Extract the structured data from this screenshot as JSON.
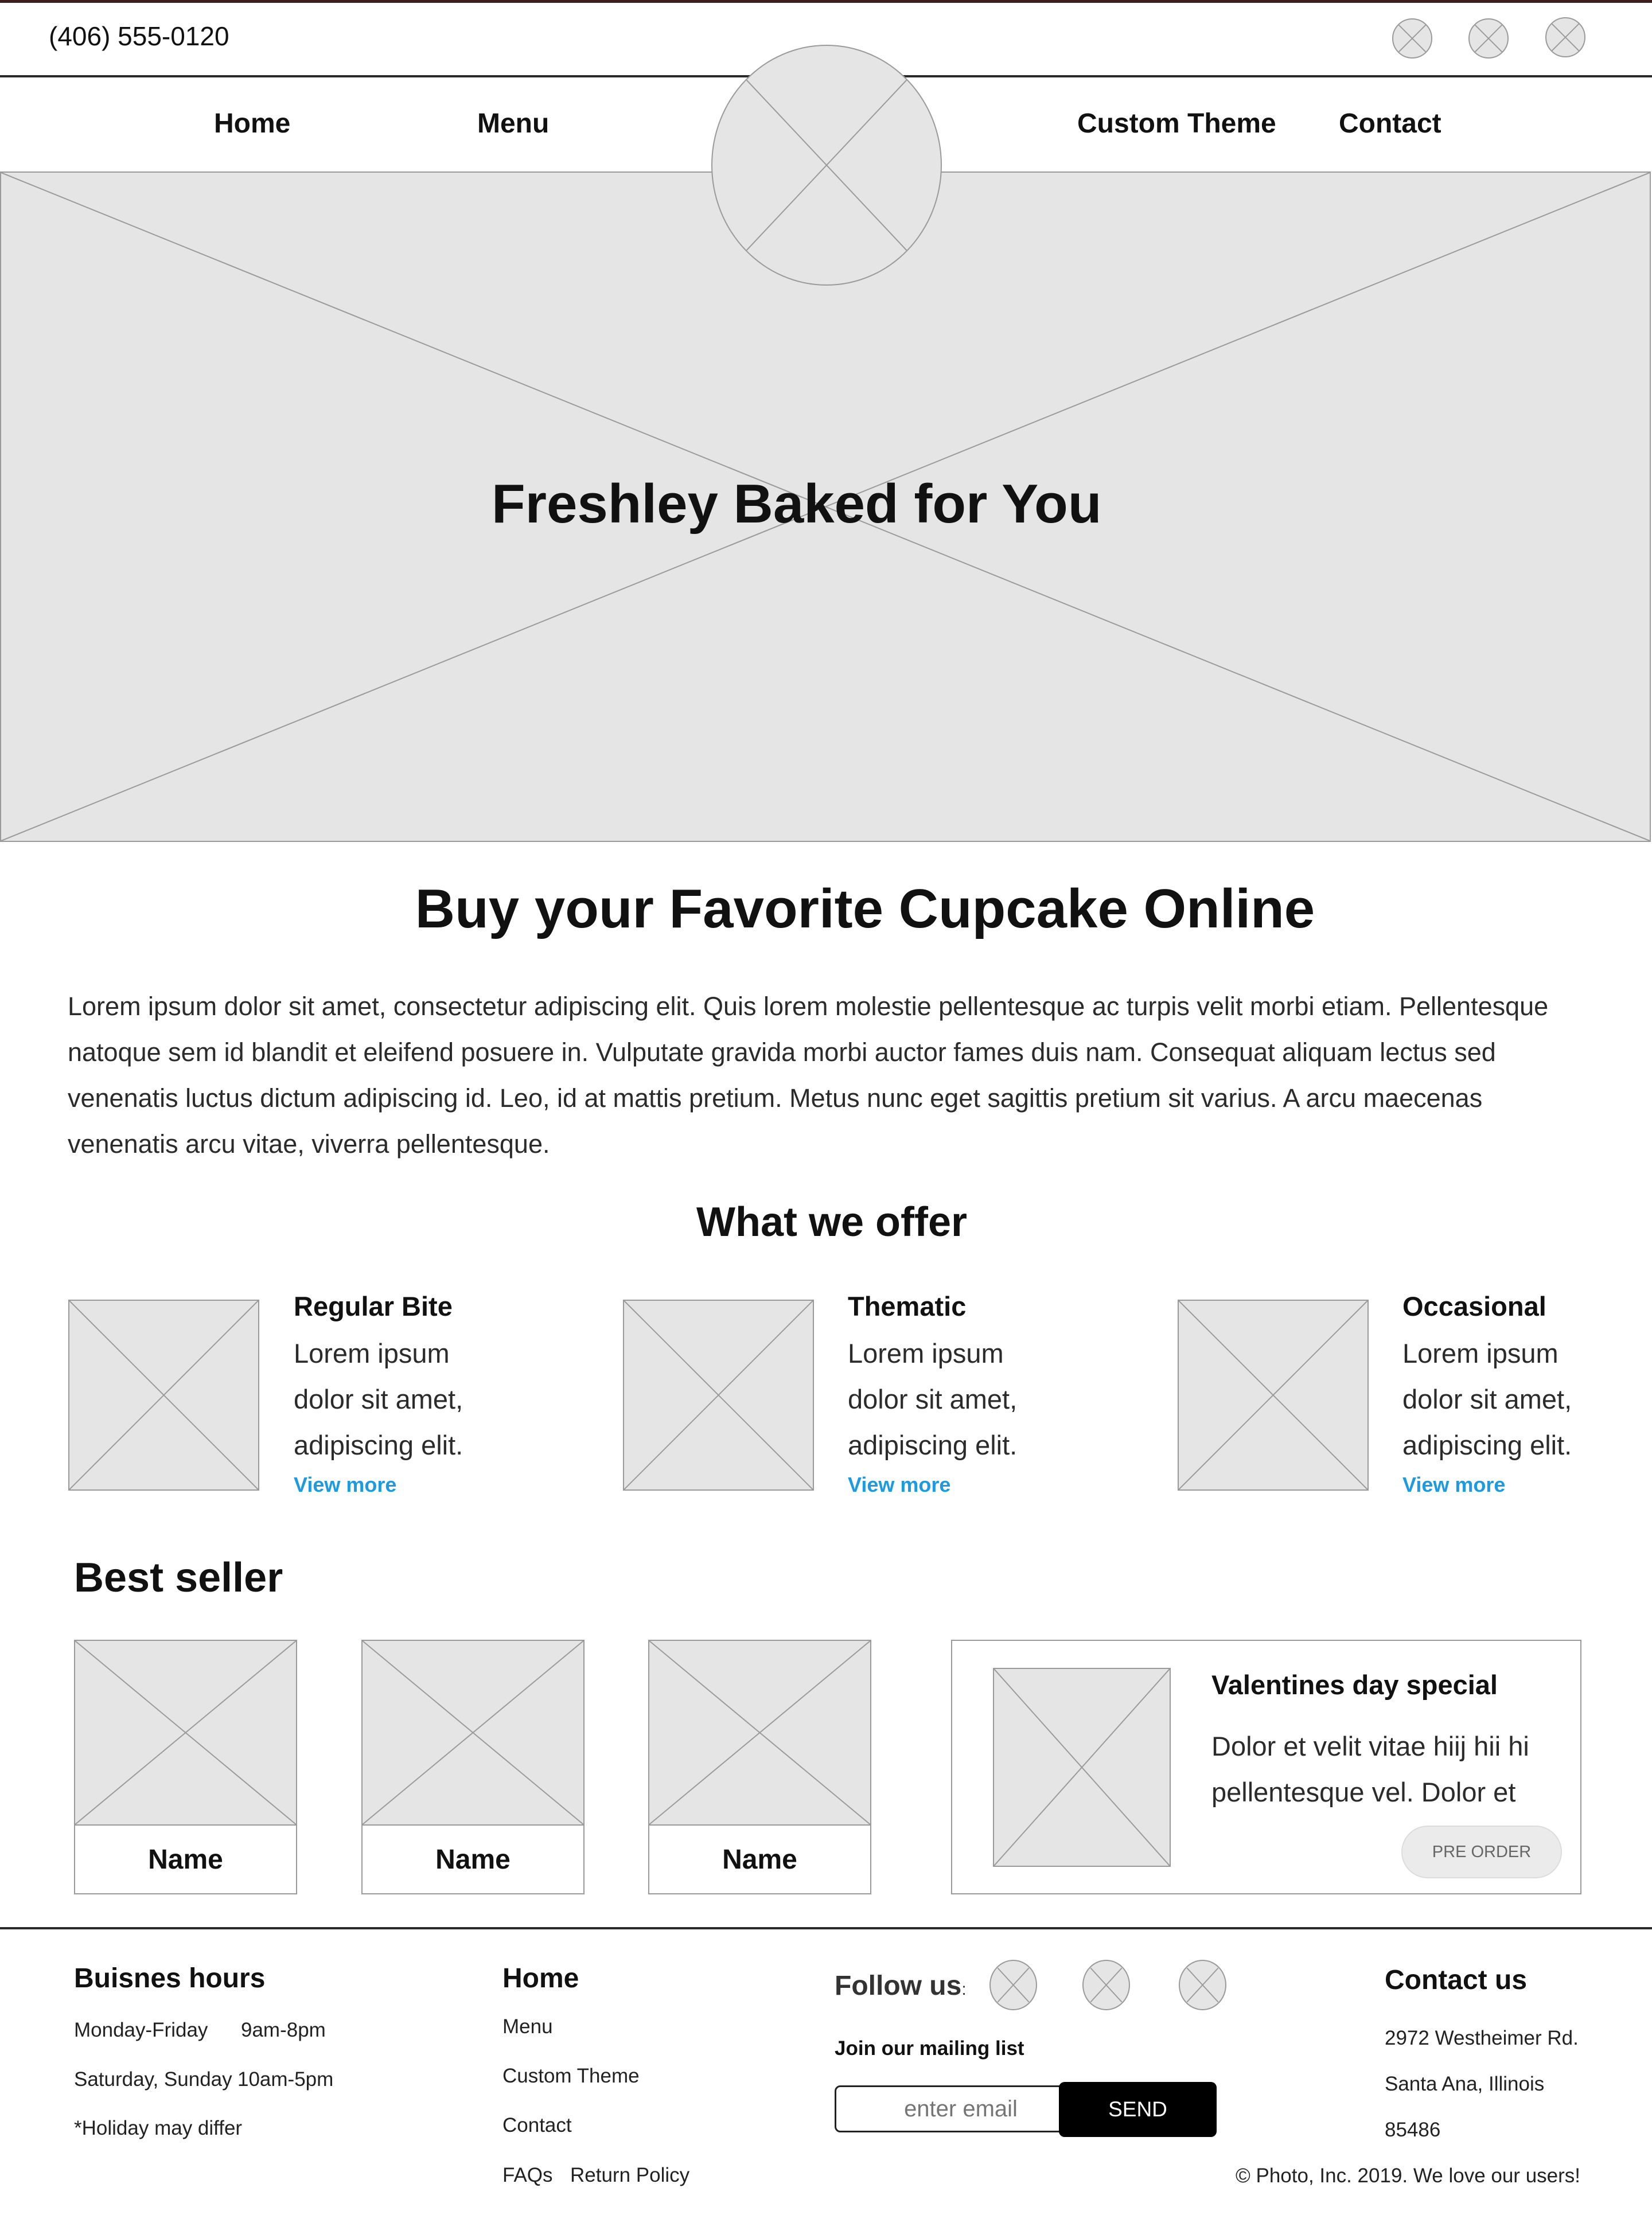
{
  "topbar": {
    "phone": "(406) 555-0120",
    "social_icons": [
      "social-icon",
      "social-icon",
      "social-icon"
    ]
  },
  "nav": {
    "home": "Home",
    "menu": "Menu",
    "custom_theme": "Custom Theme",
    "contact": "Contact"
  },
  "hero": {
    "title": "Freshley Baked for You"
  },
  "intro": {
    "heading": "Buy your Favorite Cupcake Online",
    "lines": [
      "Lorem ipsum dolor sit amet, consectetur adipiscing elit. Quis lorem molestie pellentesque ac turpis velit morbi etiam. Pellentesque",
      "natoque sem id blandit et eleifend posuere in. Vulputate gravida morbi auctor fames duis nam. Consequat aliquam lectus sed",
      "venenatis luctus dictum adipiscing id. Leo, id at mattis pretium. Metus nunc eget sagittis pretium sit varius. A arcu maecenas",
      "venenatis arcu vitae, viverra pellentesque."
    ]
  },
  "offer": {
    "heading": "What we offer",
    "items": [
      {
        "title": "Regular Bite",
        "lines": [
          "Lorem ipsum",
          "dolor sit amet,",
          "adipiscing elit."
        ],
        "link": "View more"
      },
      {
        "title": "Thematic",
        "lines": [
          "Lorem ipsum",
          "dolor sit amet,",
          "adipiscing elit."
        ],
        "link": "View more"
      },
      {
        "title": "Occasional",
        "lines": [
          "Lorem ipsum",
          "dolor sit amet,",
          "adipiscing elit."
        ],
        "link": "View more"
      }
    ]
  },
  "best_seller": {
    "heading": "Best seller",
    "products": [
      {
        "name": "Name"
      },
      {
        "name": "Name"
      },
      {
        "name": "Name"
      }
    ],
    "special": {
      "title": "Valentines day special",
      "lines": [
        "Dolor et velit vitae hiij hii hi",
        "pellentesque vel. Dolor et"
      ],
      "button": "PRE ORDER"
    }
  },
  "footer": {
    "hours": {
      "heading": "Buisnes hours",
      "row1_days": "Monday-Friday",
      "row1_time": "9am-8pm",
      "row2_days": "Saturday, Sunday",
      "row2_time": "10am-5pm",
      "note": "*Holiday may differ"
    },
    "links": {
      "home": "Home",
      "menu": "Menu",
      "custom_theme": "Custom Theme",
      "contact": "Contact",
      "faqs": "FAQs",
      "return_policy": "Return Policy"
    },
    "follow": {
      "label": "Follow us",
      "colon": ":",
      "mailing": "Join our mailing list",
      "email_placeholder": "enter email",
      "send": "SEND"
    },
    "contact": {
      "heading": "Contact us",
      "address1": "2972 Westheimer Rd.",
      "address2": "Santa Ana, Illinois",
      "zip": "85486"
    },
    "copyright": "© Photo, Inc. 2019. We love our users!"
  }
}
